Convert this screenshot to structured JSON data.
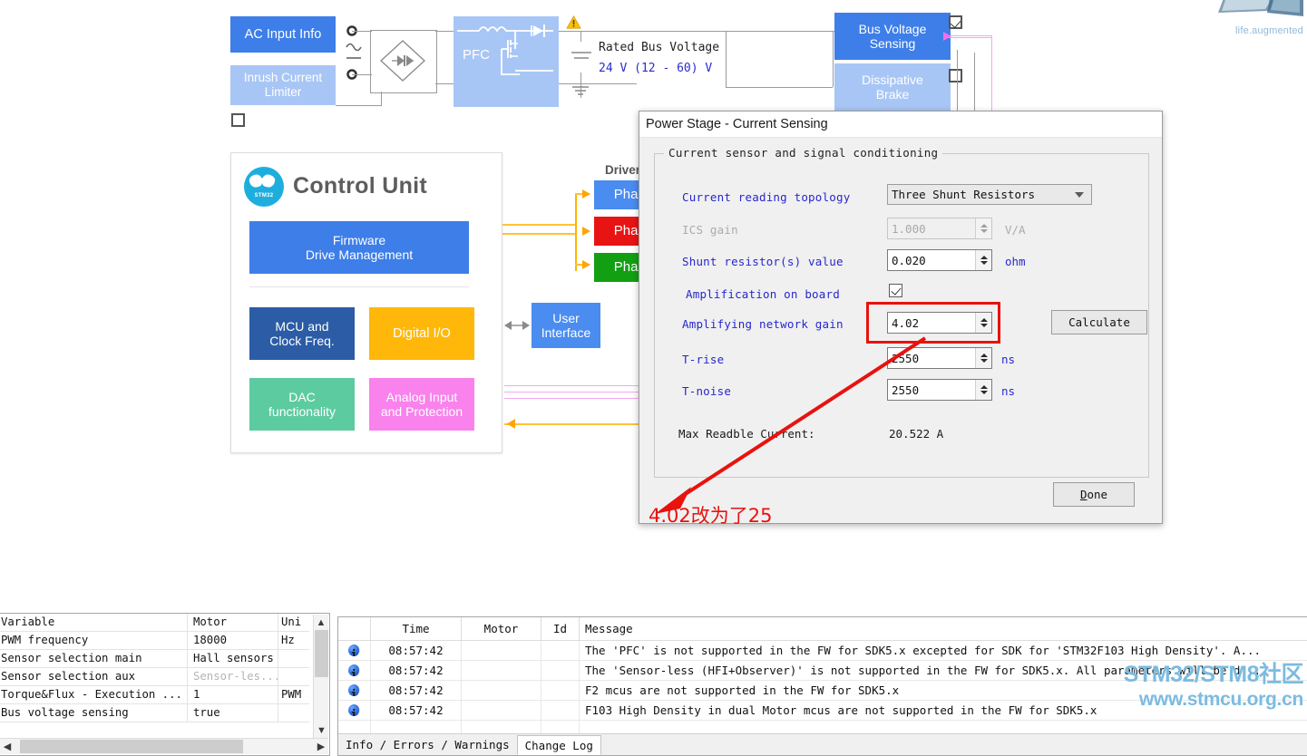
{
  "watermarks": {
    "st_tagline": "life.augmented",
    "forum_line1": "STM32/STM8社区",
    "forum_line2": "www.stmcu.org.cn"
  },
  "diagram": {
    "power_stage": {
      "ac_input_info": "AC Input Info",
      "inrush_current_limiter": "Inrush Current\nLimiter",
      "pfc": "PFC",
      "rated_bus_voltage_label": "Rated Bus Voltage",
      "rated_bus_voltage_value": "24 V (12 - 60) V",
      "bus_voltage_sensing": "Bus Voltage\nSensing",
      "dissipative_brake": "Dissipative\nBrake",
      "checkbox_inrush": false,
      "checkbox_bus_voltage": true,
      "checkbox_dissipative_brake": false
    },
    "control_unit": {
      "title": "Control Unit",
      "logo_text": "STM32",
      "firmware": "Firmware\nDrive Management",
      "mcu_clock": "MCU and\nClock Freq.",
      "digital_io": "Digital I/O",
      "dac": "DAC\nfunctionality",
      "analog": "Analog Input\nand Protection"
    },
    "drivers": {
      "header": "Drivers",
      "phase_a": "Phase",
      "phase_b": "Phase",
      "phase_c": "Phase",
      "user_interface": "User\nInterface"
    },
    "colors": {
      "blue_primary": "#3d7ee8",
      "blue_light": "#a8c6f5",
      "blue_dark": "#2b5ca5",
      "amber": "#ffb80a",
      "green": "#5ccba0",
      "pink": "#f982ec",
      "phase_blue": "#4a8cf0",
      "phase_red": "#e81414",
      "phase_green": "#12a012",
      "wire_orange": "#ffb400",
      "wire_magenta": "#f3a7ef",
      "logo_cyan": "#1eaede"
    }
  },
  "dialog": {
    "title": "Power Stage - Current Sensing",
    "group_legend": "Current sensor and signal conditioning",
    "fields": {
      "topology_label": "Current reading topology",
      "topology_value": "Three Shunt Resistors",
      "ics_gain_label": "ICS gain",
      "ics_gain_value": "1.000",
      "ics_gain_unit": "V/A",
      "shunt_label": "Shunt resistor(s) value",
      "shunt_value": "0.020",
      "shunt_unit": "ohm",
      "amplification_label": "Amplification on board",
      "amplification_checked": true,
      "gain_label": "Amplifying network gain",
      "gain_value": "4.02",
      "trise_label": "T-rise",
      "trise_value": "2550",
      "trise_unit": "ns",
      "tnoise_label": "T-noise",
      "tnoise_value": "2550",
      "tnoise_unit": "ns",
      "max_current_label": "Max Readble Current:",
      "max_current_value": "20.522 A"
    },
    "buttons": {
      "calculate": "Calculate",
      "done_underline": "D",
      "done_rest": "one"
    },
    "annotation": {
      "text": "4.02改为了25",
      "color": "#e8120e"
    }
  },
  "variables_panel": {
    "columns": [
      "Variable",
      "Motor",
      "Uni"
    ],
    "rows": [
      {
        "variable": "PWM frequency",
        "motor": "18000",
        "unit": "Hz",
        "dim": false
      },
      {
        "variable": "Sensor selection main",
        "motor": "Hall sensors",
        "unit": "",
        "dim": false
      },
      {
        "variable": "Sensor selection aux",
        "motor": "Sensor-les...",
        "unit": "",
        "dim": true
      },
      {
        "variable": "Torque&Flux - Execution ...",
        "motor": "1",
        "unit": "PWM",
        "dim": false
      },
      {
        "variable": "Bus voltage sensing",
        "motor": "true",
        "unit": "",
        "dim": false
      }
    ]
  },
  "log_panel": {
    "columns": [
      "",
      "Time",
      "Motor",
      "Id",
      "Message"
    ],
    "rows": [
      {
        "icon": "info-icon",
        "time": "08:57:42",
        "motor": "",
        "id": "",
        "message": "The 'PFC' is not supported in the FW for SDK5.x excepted for SDK for 'STM32F103 High Density'. A..."
      },
      {
        "icon": "info-icon",
        "time": "08:57:42",
        "motor": "",
        "id": "",
        "message": "The 'Sensor-less (HFI+Observer)' is not supported in the FW for SDK5.x. All parameters will be d..."
      },
      {
        "icon": "info-icon",
        "time": "08:57:42",
        "motor": "",
        "id": "",
        "message": "F2 mcus are not supported in the FW for SDK5.x"
      },
      {
        "icon": "info-icon",
        "time": "08:57:42",
        "motor": "",
        "id": "",
        "message": "F103 High Density in dual Motor mcus are not supported in the FW for SDK5.x"
      }
    ],
    "tabs": [
      {
        "label": "Info / Errors / Warnings",
        "active": false
      },
      {
        "label": "Change Log",
        "active": true
      }
    ]
  }
}
